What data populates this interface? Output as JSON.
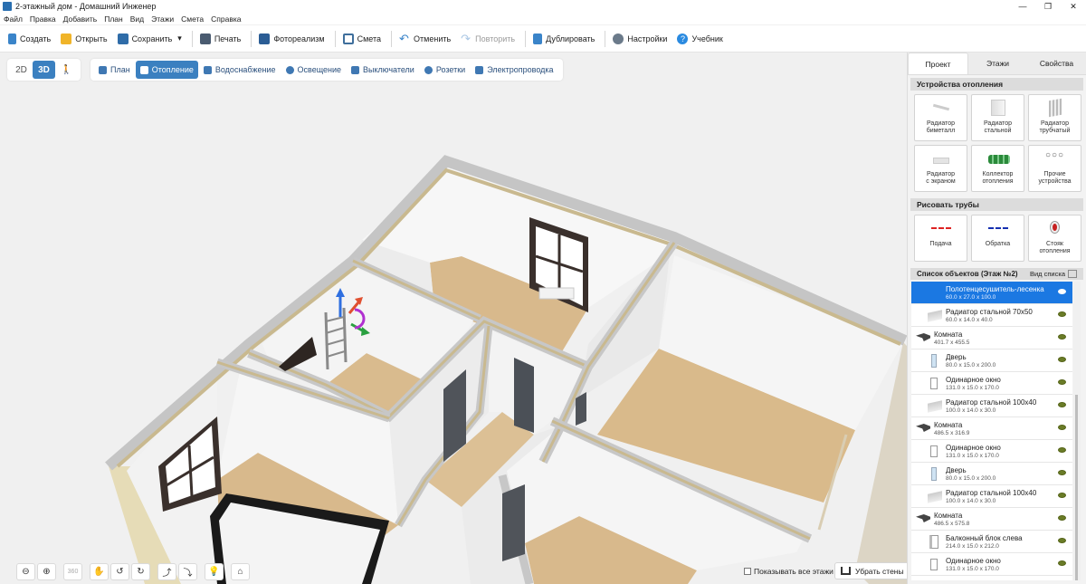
{
  "window": {
    "title": "2-этажный дом - Домашний Инженер",
    "minimize": "—",
    "maximize": "❐",
    "close": "✕"
  },
  "menu": [
    "Файл",
    "Правка",
    "Добавить",
    "План",
    "Вид",
    "Этажи",
    "Смета",
    "Справка"
  ],
  "toolbar": {
    "create": "Создать",
    "open": "Открыть",
    "save": "Сохранить",
    "save_dropdown": "▾",
    "print": "Печать",
    "photorealism": "Фотореализм",
    "estimate": "Смета",
    "undo": "Отменить",
    "redo": "Повторить",
    "duplicate": "Дублировать",
    "settings": "Настройки",
    "tutorial": "Учебник"
  },
  "view_modes": {
    "mode_2d": "2D",
    "mode_3d": "3D",
    "walk": "🚶",
    "active": "3D"
  },
  "layers": [
    "План",
    "Отопление",
    "Водоснабжение",
    "Освещение",
    "Выключатели",
    "Розетки",
    "Электропроводка"
  ],
  "active_layer": "Отопление",
  "bottom": {
    "show_all_floors": "Показывать все этажи",
    "show_all_checked": false,
    "remove_walls": "Убрать стены",
    "tool_icons": [
      "zoom-out-icon",
      "zoom-in-icon",
      "rotate-360-icon",
      "pan-hand-icon",
      "rotate-left-icon",
      "rotate-right-icon",
      "tilt-up-icon",
      "tilt-down-icon",
      "light-bulb-icon",
      "home-icon"
    ],
    "rotate_label": "360"
  },
  "panel": {
    "tabs": [
      "Проект",
      "Этажи",
      "Свойства"
    ],
    "active_tab": "Проект",
    "heating_section": "Устройства отопления",
    "heating_devices": [
      {
        "l1": "Радиатор",
        "l2": "биметалл"
      },
      {
        "l1": "Радиатор",
        "l2": "стальной"
      },
      {
        "l1": "Радиатор",
        "l2": "трубчатый"
      },
      {
        "l1": "Радиатор",
        "l2": "с экраном"
      },
      {
        "l1": "Коллектор",
        "l2": "отопления"
      },
      {
        "l1": "Прочие",
        "l2": "устройства"
      }
    ],
    "pipes_section": "Рисовать трубы",
    "pipes": [
      {
        "l1": "Подача",
        "l2": ""
      },
      {
        "l1": "Обратка",
        "l2": ""
      },
      {
        "l1": "Стояк",
        "l2": "отопления"
      }
    ],
    "objects_header": "Список объектов (Этаж №2)",
    "list_view": "Вид списка",
    "objects": [
      {
        "name": "Полотенцесушитель-лесенка",
        "size": "60.0 x 27.0 x 100.0",
        "kind": "towel",
        "indent": 1,
        "selected": true
      },
      {
        "name": "Радиатор стальной 70x50",
        "size": "60.0 x 14.0 x 40.0",
        "kind": "radiator",
        "indent": 1,
        "selected": false
      },
      {
        "name": "Комната",
        "size": "401.7 x 455.5",
        "kind": "room",
        "indent": 0,
        "selected": false
      },
      {
        "name": "Дверь",
        "size": "80.0 x 15.0 x 200.0",
        "kind": "door",
        "indent": 1,
        "selected": false
      },
      {
        "name": "Одинарное окно",
        "size": "131.0 x 15.0 x 170.0",
        "kind": "window",
        "indent": 1,
        "selected": false
      },
      {
        "name": "Радиатор стальной 100x40",
        "size": "100.0 x 14.0 x 30.0",
        "kind": "radiator",
        "indent": 1,
        "selected": false
      },
      {
        "name": "Комната",
        "size": "486.5 x 316.9",
        "kind": "room",
        "indent": 0,
        "selected": false
      },
      {
        "name": "Одинарное окно",
        "size": "131.0 x 15.0 x 170.0",
        "kind": "window",
        "indent": 1,
        "selected": false
      },
      {
        "name": "Дверь",
        "size": "80.0 x 15.0 x 200.0",
        "kind": "door",
        "indent": 1,
        "selected": false
      },
      {
        "name": "Радиатор стальной 100x40",
        "size": "100.0 x 14.0 x 30.0",
        "kind": "radiator",
        "indent": 1,
        "selected": false
      },
      {
        "name": "Комната",
        "size": "486.5 x 575.8",
        "kind": "room",
        "indent": 0,
        "selected": false
      },
      {
        "name": "Балконный блок слева",
        "size": "214.0 x 15.0 x 212.0",
        "kind": "balcony",
        "indent": 1,
        "selected": false
      },
      {
        "name": "Одинарное окно",
        "size": "131.0 x 15.0 x 170.0",
        "kind": "window",
        "indent": 1,
        "selected": false
      }
    ]
  },
  "colors": {
    "accent": "#3b80c0",
    "selection": "#1b78e2",
    "floor": "#d8b98c",
    "wall_top": "#c9b98f",
    "wall": "#f6f6f6"
  }
}
